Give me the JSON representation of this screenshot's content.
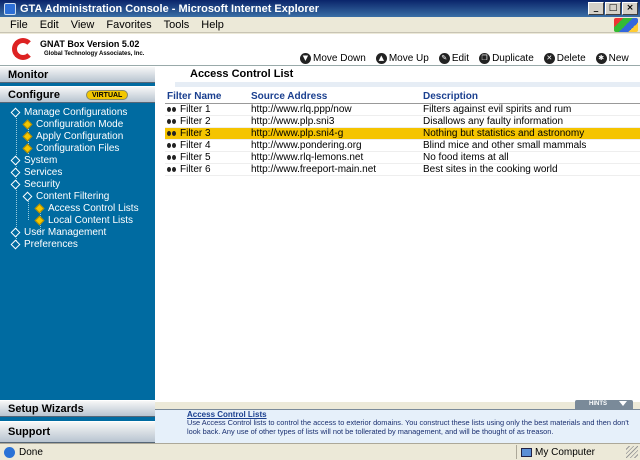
{
  "window": {
    "title": "GTA Administration Console - Microsoft Internet Explorer",
    "btn_min": "_",
    "btn_max": "□",
    "btn_close": "×"
  },
  "menu": [
    "File",
    "Edit",
    "View",
    "Favorites",
    "Tools",
    "Help"
  ],
  "logo": {
    "brand": "GNAT Box Version 5.02",
    "company": "Global Technology Associates, Inc."
  },
  "toolbar": {
    "move_down": "Move Down",
    "move_up": "Move Up",
    "edit": "Edit",
    "duplicate": "Duplicate",
    "delete": "Delete",
    "new": "New"
  },
  "sidebar": {
    "monitor": "Monitor",
    "configure": "Configure",
    "virtual_badge": "VIRTUAL",
    "setup_wizards": "Setup Wizards",
    "support": "Support",
    "tree": [
      "Manage Configurations",
      "Configuration Mode",
      "Apply Configuration",
      "Configuration Files",
      "System",
      "Services",
      "Security",
      "Content Filtering",
      "Access Control Lists",
      "Local Content Lists",
      "User Management",
      "Preferences"
    ]
  },
  "main": {
    "title": "Access Control List",
    "columns": {
      "name": "Filter Name",
      "address": "Source Address",
      "description": "Description"
    },
    "rows": [
      {
        "name": "Filter 1",
        "address": "http://www.rlq.ppp/now",
        "description": "Filters against evil spirits and rum"
      },
      {
        "name": "Filter 2",
        "address": "http://www.plp.sni3",
        "description": "Disallows any faulty information"
      },
      {
        "name": "Filter 3",
        "address": "http://www.plp.sni4-g",
        "description": "Nothing but statistics and astronomy"
      },
      {
        "name": "Filter 4",
        "address": "http://www.pondering.org",
        "description": "Blind mice and other small mammals"
      },
      {
        "name": "Filter 5",
        "address": "http://www.rlq-lemons.net",
        "description": "No food items at all"
      },
      {
        "name": "Filter 6",
        "address": "http://www.freeport-main.net",
        "description": "Best sites in the cooking world"
      }
    ],
    "selected_row": 2
  },
  "hints": {
    "tab": "HINTS",
    "title": "Access Control Lists",
    "text": "Use Access Control lists to control the access to exterior domains. You construct these lists using only the best materials and then don't look back. Any use of other types of lists will not be tollerated by management, and will be thought of as treason."
  },
  "status": {
    "left": "Done",
    "zone": "My Computer"
  },
  "colors": {
    "sidebar": "#006ba1",
    "selection": "#f5c400",
    "header_text": "#1a3f8f"
  }
}
